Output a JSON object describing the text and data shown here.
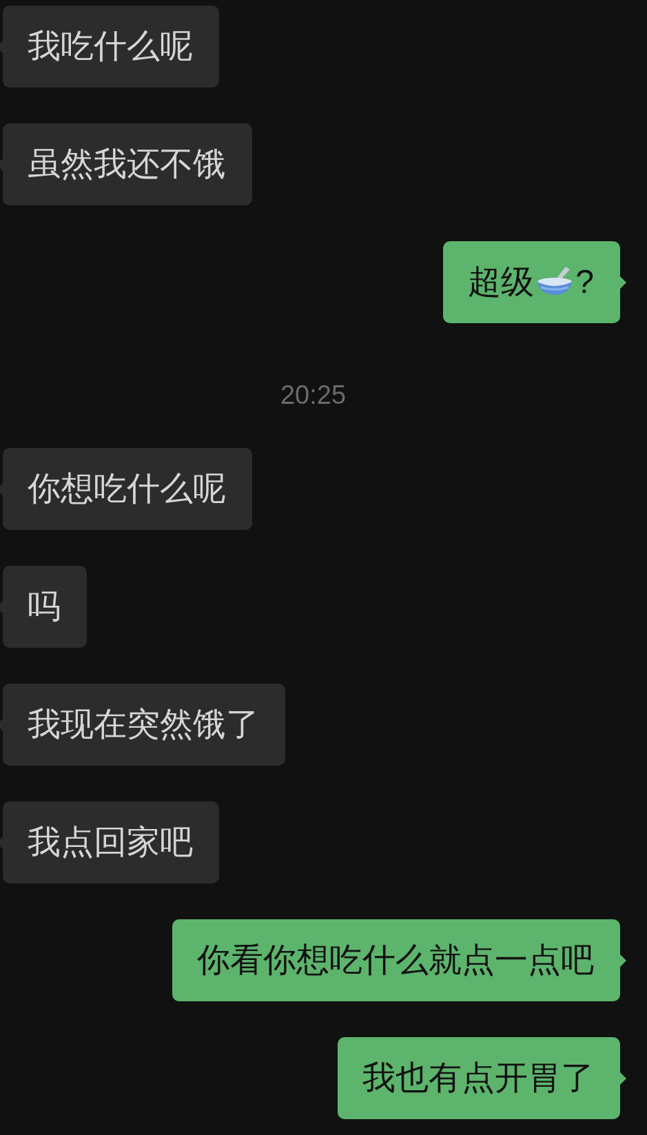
{
  "messages": [
    {
      "kind": "message",
      "outgoing": false,
      "segments": [
        {
          "kind": "text",
          "text": "我吃什么呢"
        }
      ]
    },
    {
      "kind": "message",
      "outgoing": false,
      "segments": [
        {
          "kind": "text",
          "text": "虽然我还不饿"
        }
      ]
    },
    {
      "kind": "message",
      "outgoing": true,
      "segments": [
        {
          "kind": "text",
          "text": "超级"
        },
        {
          "kind": "emoji"
        },
        {
          "kind": "text",
          "text": "?"
        }
      ]
    },
    {
      "kind": "time",
      "text": "20:25"
    },
    {
      "kind": "message",
      "outgoing": false,
      "segments": [
        {
          "kind": "text",
          "text": "你想吃什么呢"
        }
      ]
    },
    {
      "kind": "message",
      "outgoing": false,
      "segments": [
        {
          "kind": "text",
          "text": "吗"
        }
      ]
    },
    {
      "kind": "message",
      "outgoing": false,
      "segments": [
        {
          "kind": "text",
          "text": "我现在突然饿了"
        }
      ]
    },
    {
      "kind": "message",
      "outgoing": false,
      "segments": [
        {
          "kind": "text",
          "text": "我点回家吧"
        }
      ]
    },
    {
      "kind": "message",
      "outgoing": true,
      "segments": [
        {
          "kind": "text",
          "text": "你看你想吃什么就点一点吧"
        }
      ]
    },
    {
      "kind": "message",
      "outgoing": true,
      "segments": [
        {
          "kind": "text",
          "text": "我也有点开胃了"
        }
      ]
    }
  ]
}
